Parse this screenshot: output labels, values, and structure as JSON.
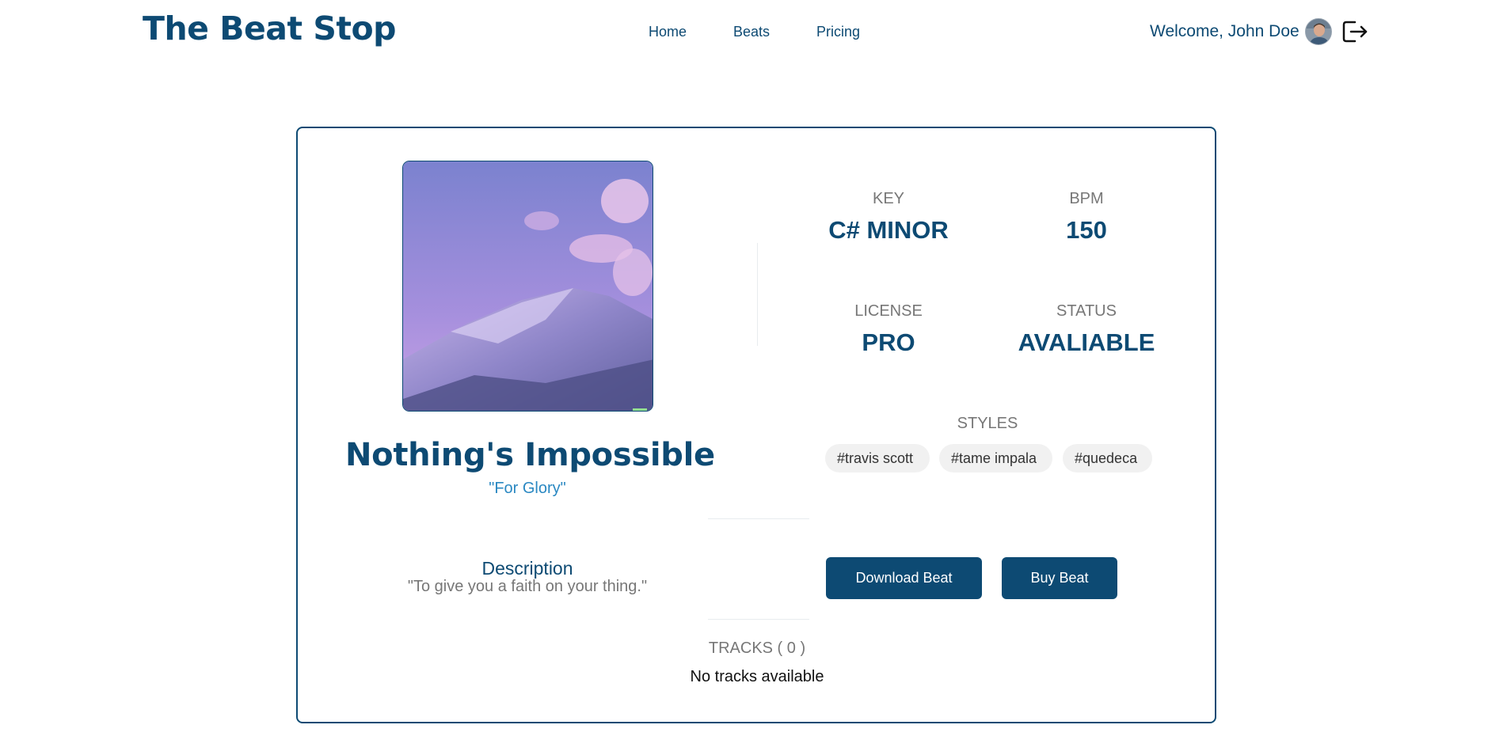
{
  "header": {
    "logo": "The Beat Stop",
    "nav": [
      {
        "label": "Home"
      },
      {
        "label": "Beats"
      },
      {
        "label": "Pricing"
      }
    ],
    "welcome": "Welcome, John Doe",
    "avatar_icon": "user-avatar",
    "logout_icon": "logout-icon"
  },
  "beat": {
    "title": "Nothing's Impossible",
    "subtitle": "\"For Glory\"",
    "cover_icon": "mountain-sunset-artwork",
    "key_label": "KEY",
    "key_value": "C# MINOR",
    "bpm_label": "BPM",
    "bpm_value": "150",
    "license_label": "LICENSE",
    "license_value": "PRO",
    "status_label": "STATUS",
    "status_value": "AVALIABLE",
    "styles_label": "STYLES",
    "styles": [
      "#travis scott",
      "#tame impala",
      "#quedeca"
    ],
    "description_title": "Description",
    "description_text": "\"To give you a faith on your thing.\"",
    "download_label": "Download Beat",
    "buy_label": "Buy Beat",
    "tracks_label": "TRACKS ( 0 )",
    "tracks_empty": "No tracks available"
  },
  "colors": {
    "primary": "#0d4a73",
    "accent": "#2a88c2",
    "muted": "#777777",
    "tag_bg": "#f1f1f1"
  }
}
